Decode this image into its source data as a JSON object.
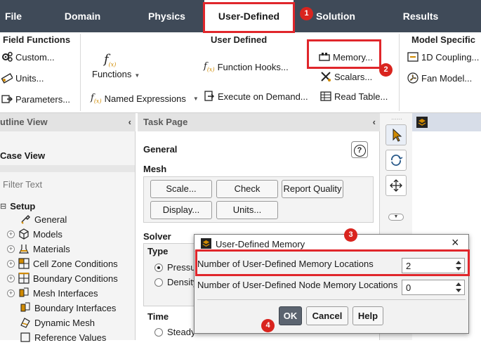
{
  "menu": [
    "File",
    "Domain",
    "Physics",
    "User-Defined",
    "Solution",
    "Results"
  ],
  "ribbon": {
    "field_functions": {
      "title": "Field Functions",
      "items": [
        "Custom...",
        "Units...",
        "Parameters..."
      ]
    },
    "user_defined": {
      "title": "User Defined",
      "functions_label": "Functions",
      "named_expressions": "Named Expressions",
      "function_hooks": "Function Hooks...",
      "execute_on_demand": "Execute on Demand...",
      "memory": "Memory...",
      "scalars": "Scalars...",
      "read_table": "Read Table..."
    },
    "model_specific": {
      "title": "Model Specific",
      "coupling": "1D Coupling...",
      "fan_model": "Fan Model..."
    }
  },
  "outline": {
    "title": "utline View",
    "case_view": "Case View",
    "filter_placeholder": "Filter Text",
    "tree": {
      "setup": "Setup",
      "items": [
        "General",
        "Models",
        "Materials",
        "Cell Zone Conditions",
        "Boundary Conditions",
        "Mesh Interfaces",
        "Boundary Interfaces",
        "Dynamic Mesh",
        "Reference Values"
      ]
    }
  },
  "task_page": {
    "title": "Task Page",
    "general": "General",
    "help_glyph": "?",
    "mesh": "Mesh",
    "buttons": {
      "scale": "Scale...",
      "check": "Check",
      "report_quality": "Report Quality",
      "display": "Display...",
      "units": "Units..."
    },
    "solver": "Solver",
    "type": "Type",
    "type_options": [
      "Pressu",
      "Density"
    ],
    "time": "Time",
    "time_options": [
      "Steady"
    ]
  },
  "dialog": {
    "title": "User-Defined Memory",
    "close_glyph": "×",
    "memory_locations_label": "Number of User-Defined Memory Locations",
    "memory_locations_value": "2",
    "node_memory_label": "Number of User-Defined Node Memory Locations",
    "node_memory_value": "0",
    "ok": "OK",
    "cancel": "Cancel",
    "help": "Help"
  },
  "annotations": [
    "1",
    "2",
    "3",
    "4"
  ],
  "colors": {
    "menubar": "#3f4a58",
    "annotation_red": "#e0262b",
    "accent_orange": "#d08a00"
  }
}
